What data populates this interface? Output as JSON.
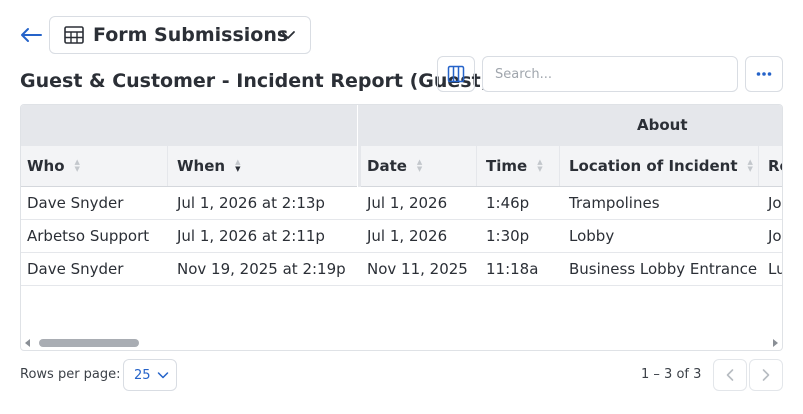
{
  "header": {
    "form_selector_label": "Form Submissions"
  },
  "page": {
    "title": "Guest & Customer - Incident Report (Guest)"
  },
  "toolbar": {
    "search_placeholder": "Search..."
  },
  "table": {
    "group_headers": [
      "",
      "About"
    ],
    "columns": [
      {
        "label": "Who",
        "sort": "none"
      },
      {
        "label": "When",
        "sort": "desc"
      },
      {
        "label": "Date",
        "sort": "none"
      },
      {
        "label": "Time",
        "sort": "none"
      },
      {
        "label": "Location of Incident",
        "sort": "none"
      },
      {
        "label": "Re",
        "sort": "none"
      }
    ],
    "rows": [
      [
        "Dave Snyder",
        "Jul 1, 2026 at 2:13p",
        "Jul 1, 2026",
        "1:46p",
        "Trampolines",
        "Jo"
      ],
      [
        "Arbetso Support",
        "Jul 1, 2026 at 2:11p",
        "Jul 1, 2026",
        "1:30p",
        "Lobby",
        "Jo"
      ],
      [
        "Dave Snyder",
        "Nov 19, 2025 at 2:19p",
        "Nov 11, 2025",
        "11:18a",
        "Business Lobby Entrance",
        "Lu"
      ]
    ]
  },
  "footer": {
    "rows_per_page_label": "Rows per page:",
    "rows_per_page_value": "25",
    "range_text": "1 – 3 of 3"
  },
  "colors": {
    "accent": "#2563c9",
    "header_bg": "#e5e7eb"
  }
}
